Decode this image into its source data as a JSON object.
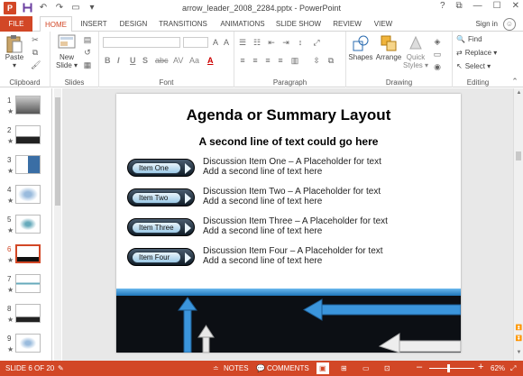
{
  "window": {
    "title": "arrow_leader_2008_2284.pptx - PowerPoint",
    "help": "?",
    "restore": "⧉",
    "minimize": "—",
    "maximize": "☐",
    "close": "✕"
  },
  "qat": {
    "logo": "P",
    "icons": [
      "save-icon",
      "undo-icon",
      "redo-icon",
      "start-slideshow-icon",
      "customize-qat-icon"
    ]
  },
  "tabs": [
    "FILE",
    "HOME",
    "INSERT",
    "DESIGN",
    "TRANSITIONS",
    "ANIMATIONS",
    "SLIDE SHOW",
    "REVIEW",
    "VIEW"
  ],
  "active_tab": "HOME",
  "account": {
    "signin": "Sign in"
  },
  "ribbon": {
    "clipboard": {
      "label": "Clipboard",
      "paste": "Paste"
    },
    "slides": {
      "label": "Slides",
      "new_slide": "New",
      "new_slide2": "Slide ▾"
    },
    "font": {
      "label": "Font",
      "bold": "B",
      "italic": "I",
      "underline": "U",
      "strike": "S",
      "abc": "abc",
      "av": "AV",
      "aa": "Aa",
      "a_color": "A"
    },
    "paragraph": {
      "label": "Paragraph"
    },
    "drawing": {
      "label": "Drawing",
      "shapes": "Shapes",
      "arrange": "Arrange",
      "quick_styles": "Quick",
      "quick_styles2": "Styles ▾"
    },
    "editing": {
      "label": "Editing",
      "find": "Find",
      "replace": "Replace ▾",
      "select": "Select ▾"
    }
  },
  "thumbnails": [
    {
      "num": "1",
      "star": "★"
    },
    {
      "num": "2",
      "star": "★"
    },
    {
      "num": "3",
      "star": "★"
    },
    {
      "num": "4",
      "star": "★"
    },
    {
      "num": "5",
      "star": "★"
    },
    {
      "num": "6",
      "star": "★"
    },
    {
      "num": "7",
      "star": "★"
    },
    {
      "num": "8",
      "star": "★"
    },
    {
      "num": "9",
      "star": "★"
    }
  ],
  "active_slide": 6,
  "slide": {
    "title": "Agenda or Summary Layout",
    "subtitle": "A second line of text could go here",
    "items": [
      {
        "button": "Item One",
        "line1": "Discussion Item One – A Placeholder for text",
        "line2": "Add a second line of text here"
      },
      {
        "button": "Item Two",
        "line1": "Discussion Item Two – A Placeholder for text",
        "line2": "Add a second line of text here"
      },
      {
        "button": "Item Three",
        "line1": "Discussion Item Three – A Placeholder for text",
        "line2": "Add a second line of text here"
      },
      {
        "button": "Item Four",
        "line1": "Discussion Item Four – A Placeholder for text",
        "line2": "Add a second line of text here"
      }
    ]
  },
  "status": {
    "slide_info": "SLIDE 6 OF 20",
    "notes": "NOTES",
    "comments": "COMMENTS",
    "zoom_minus": "–",
    "zoom_plus": "+",
    "zoom": "62%"
  },
  "colors": {
    "accent": "#d24726",
    "band": "#0c0f14",
    "arrow_blue": "#2f8bd6"
  }
}
